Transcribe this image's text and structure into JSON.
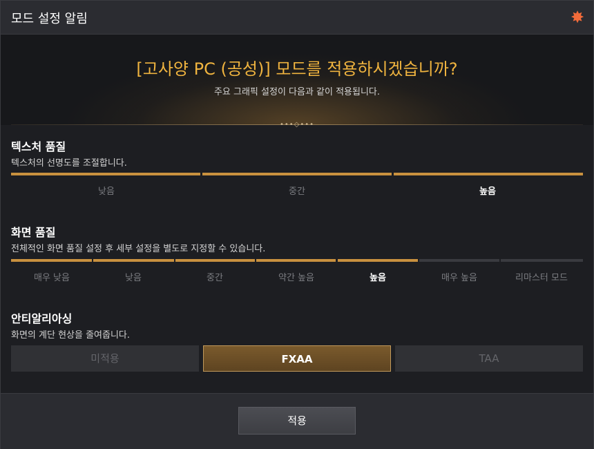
{
  "window": {
    "title": "모드 설정 알림",
    "close_icon": "starfish-close-icon",
    "accent": "#f26b3a"
  },
  "hero": {
    "headline": "[고사양 PC (공성)] 모드를 적용하시겠습니까?",
    "subline": "주요 그래픽 설정이 다음과 같이 적용됩니다.",
    "ornament": "•••◇•••"
  },
  "texture": {
    "title": "텍스처 품질",
    "desc": "텍스처의 선명도를 조절합니다.",
    "options": [
      "낮음",
      "중간",
      "높음"
    ],
    "selected": "높음"
  },
  "screen": {
    "title": "화면 품질",
    "desc": "전체적인 화면 품질 설정 후 세부 설정을 별도로 지정할 수 있습니다.",
    "options": [
      "매우 낮음",
      "낮음",
      "중간",
      "약간 높음",
      "높음",
      "매우 높음",
      "리마스터 모드"
    ],
    "selected": "높음"
  },
  "aa": {
    "title": "안티알리아싱",
    "desc": "화면의 계단 현상을 줄여줍니다.",
    "options": [
      "미적용",
      "FXAA",
      "TAA"
    ],
    "selected": "FXAA"
  },
  "footer": {
    "apply_label": "적용"
  },
  "colors": {
    "gold": "#f0b43f",
    "slider_fill": "#c8913f",
    "slider_off": "#3a3b40"
  }
}
